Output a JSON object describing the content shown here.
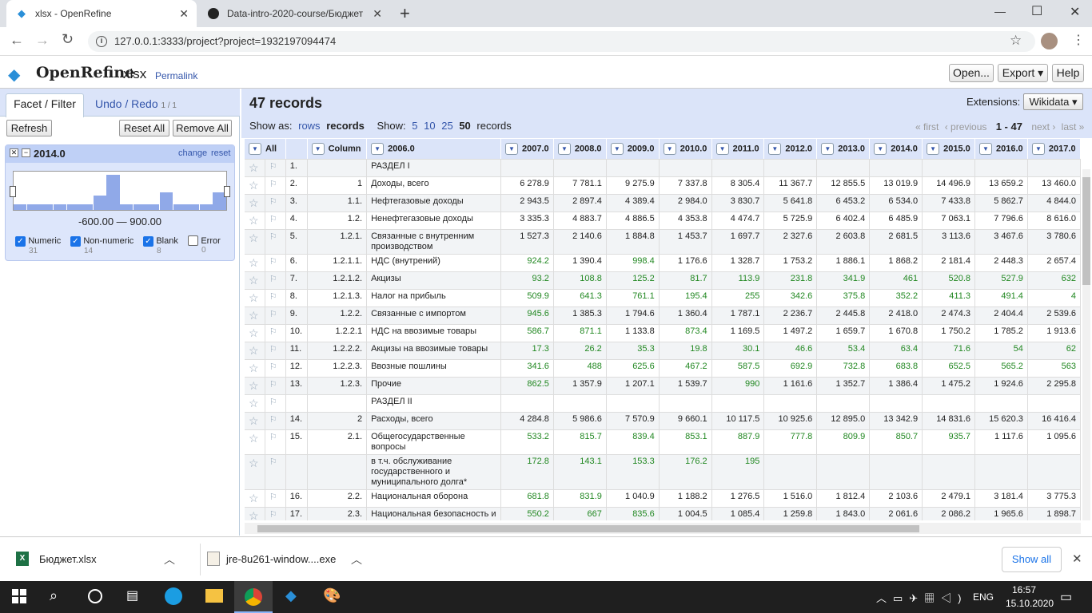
{
  "browser": {
    "tabs": [
      {
        "title": "xlsx - OpenRefine"
      },
      {
        "title": "Data-intro-2020-course/Бюджет"
      }
    ],
    "new_tab": "+",
    "url": "127.0.0.1:3333/project?project=1932197094474",
    "window_controls": {
      "minimize": "—",
      "maximize": "☐",
      "close": "✕"
    }
  },
  "app": {
    "logo": "OpenRefine",
    "project_name": "xlsx",
    "permalink": "Permalink",
    "open": "Open...",
    "export": "Export ▾",
    "help": "Help"
  },
  "left": {
    "tab_facet": "Facet / Filter",
    "tab_undo": "Undo / Redo",
    "undo_count": "1 / 1",
    "refresh": "Refresh",
    "reset_all": "Reset All",
    "remove_all": "Remove All",
    "facet": {
      "title": "2014.0",
      "change": "change",
      "reset": "reset",
      "histogram": [
        0.15,
        0.15,
        0.15,
        0.15,
        0.15,
        0.15,
        0.4,
        1.0,
        0.15,
        0.15,
        0.15,
        0.5,
        0.15,
        0.15,
        0.15,
        0.5
      ],
      "range": "-600.00 — 900.00",
      "choices": [
        {
          "label": "Numeric",
          "count": "31",
          "checked": true
        },
        {
          "label": "Non-numeric",
          "count": "14",
          "checked": true
        },
        {
          "label": "Blank",
          "count": "8",
          "checked": true
        },
        {
          "label": "Error",
          "count": "0",
          "checked": false
        }
      ]
    }
  },
  "grid_header": {
    "records": "47 records",
    "extensions_label": "Extensions:",
    "extensions_value": "Wikidata ▾",
    "show_as": "Show as:",
    "rows": "rows",
    "records_mode": "records",
    "show": "Show:",
    "sizes": [
      "5",
      "10",
      "25",
      "50"
    ],
    "records_word": "records",
    "first": "« first",
    "previous": "‹ previous",
    "range": "1 - 47",
    "next": "next ›",
    "last": "last »"
  },
  "columns": [
    "All",
    "Column",
    "2006.0",
    "2007.0",
    "2008.0",
    "2009.0",
    "2010.0",
    "2011.0",
    "2012.0",
    "2013.0",
    "2014.0",
    "2015.0",
    "2016.0",
    "2017.0"
  ],
  "rows": [
    {
      "idx": "1.",
      "col": "",
      "name": "РАЗДЕЛ I",
      "vals": [
        "",
        "",
        "",
        "",
        "",
        "",
        "",
        "",
        "",
        "",
        ""
      ],
      "h": 21
    },
    {
      "idx": "2.",
      "col": "1",
      "name": "Доходы, всего",
      "vals": [
        "6 278.9",
        "7 781.1",
        "9 275.9",
        "7 337.8",
        "8 305.4",
        "11 367.7",
        "12 855.5",
        "13 019.9",
        "14 496.9",
        "13 659.2",
        "13 460.0"
      ],
      "h": 21
    },
    {
      "idx": "3.",
      "col": "1.1.",
      "name": "Нефтегазовые доходы",
      "vals": [
        "2 943.5",
        "2 897.4",
        "4 389.4",
        "2 984.0",
        "3 830.7",
        "5 641.8",
        "6 453.2",
        "6 534.0",
        "7 433.8",
        "5 862.7",
        "4 844.0"
      ],
      "h": 21
    },
    {
      "idx": "4.",
      "col": "1.2.",
      "name": "Ненефтегазовые доходы",
      "vals": [
        "3 335.3",
        "4 883.7",
        "4 886.5",
        "4 353.8",
        "4 474.7",
        "5 725.9",
        "6 402.4",
        "6 485.9",
        "7 063.1",
        "7 796.6",
        "8 616.0"
      ],
      "h": 21
    },
    {
      "idx": "5.",
      "col": "1.2.1.",
      "name": "Связанные с внутренним производством",
      "vals": [
        "1 527.3",
        "2 140.6",
        "1 884.8",
        "1 453.7",
        "1 697.7",
        "2 327.6",
        "2 603.8",
        "2 681.5",
        "3 113.6",
        "3 467.6",
        "3 780.6"
      ],
      "h": 31
    },
    {
      "idx": "6.",
      "col": "1.2.1.1.",
      "name": "НДС (внутрений)",
      "vals": [
        "924.2",
        "1 390.4",
        "998.4",
        "1 176.6",
        "1 328.7",
        "1 753.2",
        "1 886.1",
        "1 868.2",
        "2 181.4",
        "2 448.3",
        "2 657.4"
      ],
      "h": 21
    },
    {
      "idx": "7.",
      "col": "1.2.1.2.",
      "name": "Акцизы",
      "vals": [
        "93.2",
        "108.8",
        "125.2",
        "81.7",
        "113.9",
        "231.8",
        "341.9",
        "461",
        "520.8",
        "527.9",
        "632"
      ],
      "h": 21
    },
    {
      "idx": "8.",
      "col": "1.2.1.3.",
      "name": "Налог на прибыль",
      "vals": [
        "509.9",
        "641.3",
        "761.1",
        "195.4",
        "255",
        "342.6",
        "375.8",
        "352.2",
        "411.3",
        "491.4",
        "4"
      ],
      "h": 21
    },
    {
      "idx": "9.",
      "col": "1.2.2.",
      "name": "Связанные с импортом",
      "vals": [
        "945.6",
        "1 385.3",
        "1 794.6",
        "1 360.4",
        "1 787.1",
        "2 236.7",
        "2 445.8",
        "2 418.0",
        "2 474.3",
        "2 404.4",
        "2 539.6"
      ],
      "h": 21
    },
    {
      "idx": "10.",
      "col": "1.2.2.1",
      "name": "НДС на ввозимые товары",
      "vals": [
        "586.7",
        "871.1",
        "1 133.8",
        "873.4",
        "1 169.5",
        "1 497.2",
        "1 659.7",
        "1 670.8",
        "1 750.2",
        "1 785.2",
        "1 913.6"
      ],
      "h": 21
    },
    {
      "idx": "11.",
      "col": "1.2.2.2.",
      "name": "Акцизы на ввозимые товары",
      "vals": [
        "17.3",
        "26.2",
        "35.3",
        "19.8",
        "30.1",
        "46.6",
        "53.4",
        "63.4",
        "71.6",
        "54",
        "62"
      ],
      "h": 21
    },
    {
      "idx": "12.",
      "col": "1.2.2.3.",
      "name": "Ввозные пошлины",
      "vals": [
        "341.6",
        "488",
        "625.6",
        "467.2",
        "587.5",
        "692.9",
        "732.8",
        "683.8",
        "652.5",
        "565.2",
        "563"
      ],
      "h": 21
    },
    {
      "idx": "13.",
      "col": "1.2.3.",
      "name": "Прочие",
      "vals": [
        "862.5",
        "1 357.9",
        "1 207.1",
        "1 539.7",
        "990",
        "1 161.6",
        "1 352.7",
        "1 386.4",
        "1 475.2",
        "1 924.6",
        "2 295.8"
      ],
      "h": 21
    },
    {
      "idx": "",
      "col": "",
      "name": "РАЗДЕЛ II",
      "vals": [
        "",
        "",
        "",
        "",
        "",
        "",
        "",
        "",
        "",
        "",
        ""
      ],
      "h": 21
    },
    {
      "idx": "14.",
      "col": "2",
      "name": "Расходы, всего",
      "vals": [
        "4 284.8",
        "5 986.6",
        "7 570.9",
        "9 660.1",
        "10 117.5",
        "10 925.6",
        "12 895.0",
        "13 342.9",
        "14 831.6",
        "15 620.3",
        "16 416.4"
      ],
      "h": 21
    },
    {
      "idx": "15.",
      "col": "2.1.",
      "name": "Общегосударственные вопросы",
      "vals": [
        "533.2",
        "815.7",
        "839.4",
        "853.1",
        "887.9",
        "777.8",
        "809.9",
        "850.7",
        "935.7",
        "1 117.6",
        "1 095.6"
      ],
      "h": 21
    },
    {
      "idx": "",
      "col": "",
      "name": "в т.ч. обслуживание государственного и муниципального долга*",
      "vals": [
        "172.8",
        "143.1",
        "153.3",
        "176.2",
        "195",
        "",
        "",
        "",
        "",
        "",
        ""
      ],
      "h": 44
    },
    {
      "idx": "16.",
      "col": "2.2.",
      "name": "Национальная оборона",
      "vals": [
        "681.8",
        "831.9",
        "1 040.9",
        "1 188.2",
        "1 276.5",
        "1 516.0",
        "1 812.4",
        "2 103.6",
        "2 479.1",
        "3 181.4",
        "3 775.3"
      ],
      "h": 21
    },
    {
      "idx": "17.",
      "col": "2.3.",
      "name": "Национальная безопасность и правоохранительная деятельность",
      "vals": [
        "550.2",
        "667",
        "835.6",
        "1 004.5",
        "1 085.4",
        "1 259.8",
        "1 843.0",
        "2 061.6",
        "2 086.2",
        "1 965.6",
        "1 898.7"
      ],
      "h": 44
    }
  ],
  "downloads": {
    "items": [
      {
        "name": "Бюджет.xlsx"
      },
      {
        "name": "jre-8u261-window....exe"
      }
    ],
    "show_all": "Show all"
  },
  "taskbar": {
    "lang": "ENG",
    "time": "16:57",
    "date": "15.10.2020"
  }
}
